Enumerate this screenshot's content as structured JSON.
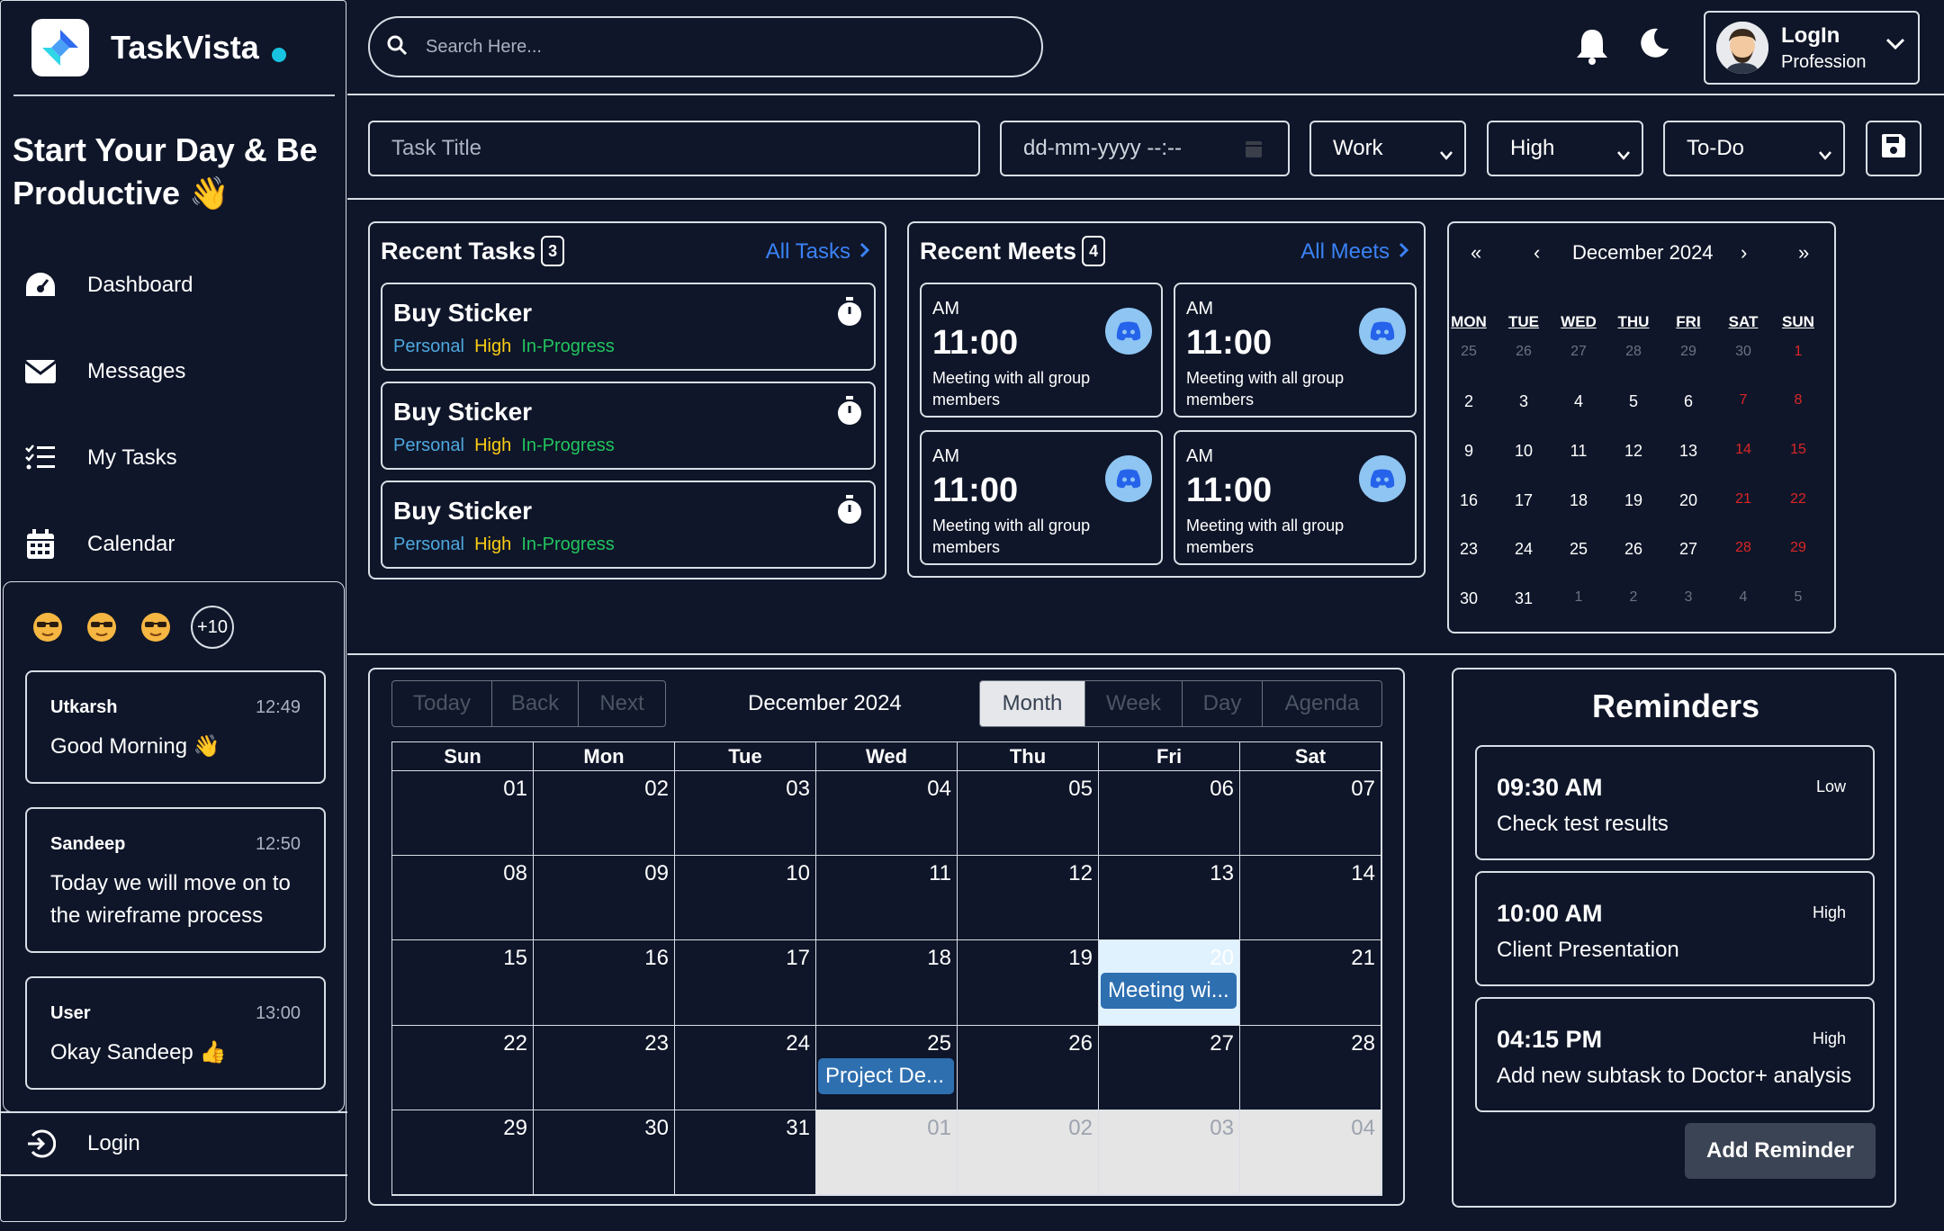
{
  "brand": {
    "name": "TaskVista"
  },
  "tagline": "Start Your Day & Be Productive 👋",
  "nav": [
    {
      "label": "Dashboard",
      "icon": "dashboard-icon"
    },
    {
      "label": "Messages",
      "icon": "envelope-icon"
    },
    {
      "label": "My Tasks",
      "icon": "list-icon"
    },
    {
      "label": "Calendar",
      "icon": "calendar-icon"
    }
  ],
  "chat": {
    "more_count": "+10",
    "messages": [
      {
        "name": "Utkarsh",
        "time": "12:49",
        "text": "Good Morning 👋"
      },
      {
        "name": "Sandeep",
        "time": "12:50",
        "text": "Today we will move on to the wireframe process"
      },
      {
        "name": "User",
        "time": "13:00",
        "text": "Okay Sandeep 👍"
      }
    ]
  },
  "login_label": "Login",
  "search": {
    "placeholder": "Search Here..."
  },
  "user": {
    "name": "LogIn",
    "role": "Profession"
  },
  "task_form": {
    "title_placeholder": "Task Title",
    "date_placeholder": "dd-mm-yyyy --:--",
    "category": "Work",
    "priority": "High",
    "status": "To-Do"
  },
  "recent_tasks": {
    "title": "Recent Tasks",
    "count": "3",
    "link": "All Tasks",
    "items": [
      {
        "title": "Buy Sticker",
        "category": "Personal",
        "priority": "High",
        "status": "In-Progress"
      },
      {
        "title": "Buy Sticker",
        "category": "Personal",
        "priority": "High",
        "status": "In-Progress"
      },
      {
        "title": "Buy Sticker",
        "category": "Personal",
        "priority": "High",
        "status": "In-Progress"
      }
    ]
  },
  "recent_meets": {
    "title": "Recent Meets",
    "count": "4",
    "link": "All Meets",
    "items": [
      {
        "period": "AM",
        "time": "11:00",
        "desc": "Meeting with all group members"
      },
      {
        "period": "AM",
        "time": "11:00",
        "desc": "Meeting with all group members"
      },
      {
        "period": "AM",
        "time": "11:00",
        "desc": "Meeting with all group members"
      },
      {
        "period": "AM",
        "time": "11:00",
        "desc": "Meeting with all group members"
      }
    ]
  },
  "mini_calendar": {
    "month": "December 2024",
    "nav": [
      "«",
      "‹",
      "›",
      "»"
    ],
    "weekdays": [
      "MON",
      "TUE",
      "WED",
      "THU",
      "FRI",
      "SAT",
      "SUN"
    ],
    "weeks": [
      [
        "25",
        "26",
        "27",
        "28",
        "29",
        "30",
        "1"
      ],
      [
        "2",
        "3",
        "4",
        "5",
        "6",
        "7",
        "8"
      ],
      [
        "9",
        "10",
        "11",
        "12",
        "13",
        "14",
        "15"
      ],
      [
        "16",
        "17",
        "18",
        "19",
        "20",
        "21",
        "22"
      ],
      [
        "23",
        "24",
        "25",
        "26",
        "27",
        "28",
        "29"
      ],
      [
        "30",
        "31",
        "1",
        "2",
        "3",
        "4",
        "5"
      ]
    ]
  },
  "big_calendar": {
    "nav": [
      "Today",
      "Back",
      "Next"
    ],
    "label": "December 2024",
    "views": [
      "Month",
      "Week",
      "Day",
      "Agenda"
    ],
    "active_view": "Month",
    "weekdays": [
      "Sun",
      "Mon",
      "Tue",
      "Wed",
      "Thu",
      "Fri",
      "Sat"
    ],
    "weeks": [
      [
        "01",
        "02",
        "03",
        "04",
        "05",
        "06",
        "07"
      ],
      [
        "08",
        "09",
        "10",
        "11",
        "12",
        "13",
        "14"
      ],
      [
        "15",
        "16",
        "17",
        "18",
        "19",
        "20",
        "21"
      ],
      [
        "22",
        "23",
        "24",
        "25",
        "26",
        "27",
        "28"
      ],
      [
        "29",
        "30",
        "31",
        "01",
        "02",
        "03",
        "04"
      ]
    ],
    "events": [
      {
        "title": "Meeting wi...",
        "date": "20"
      },
      {
        "title": "Project De...",
        "date": "25"
      }
    ]
  },
  "reminders": {
    "title": "Reminders",
    "items": [
      {
        "time": "09:30 AM",
        "priority": "Low",
        "text": "Check test results"
      },
      {
        "time": "10:00 AM",
        "priority": "High",
        "text": "Client Presentation"
      },
      {
        "time": "04:15 PM",
        "priority": "High",
        "text": "Add new subtask to Doctor+ analysis"
      }
    ],
    "add_label": "Add Reminder"
  },
  "colors": {
    "bg": "#0f1629",
    "accent": "#3b82f6",
    "personal": "#4ea8de",
    "high": "#facc15",
    "progress": "#22c55e",
    "weekend": "#dc2626",
    "event": "#2e6fb0"
  }
}
